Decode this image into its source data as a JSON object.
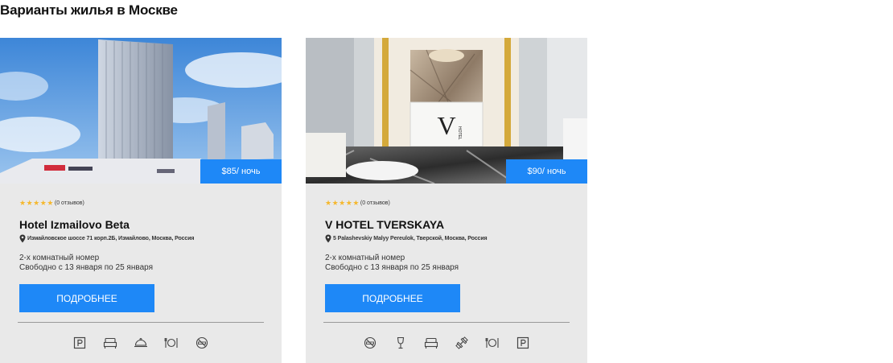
{
  "page": {
    "title": "Варианты жилья в Москве"
  },
  "colors": {
    "accent": "#1e88f7",
    "star": "#f5b82e",
    "card_bg": "#e9e9e9"
  },
  "hotels": [
    {
      "name": "Hotel Izmailovo Beta",
      "price": "$85/ ночь",
      "stars": 5,
      "reviews": "(0 отзывов)",
      "address": "Измайловское шоссе 71 корп.2Б, Измайлово, Москва, Россия",
      "room_type": "2-х комнатный номер",
      "availability": "Свободно с 13 января по 25 января",
      "button_label": "ПОДРОБНЕЕ",
      "photo": "tall-hotel-building-photo",
      "amenities": [
        "parking-icon",
        "bed-icon",
        "room-service-icon",
        "restaurant-icon",
        "no-smoking-icon"
      ]
    },
    {
      "name": "V HOTEL TVERSKAYA",
      "price": "$90/ ночь",
      "stars": 5,
      "reviews": "(0 отзывов)",
      "address": "5 Palashevskiy Malyy Pereulok, Тверской, Москва, Россия",
      "room_type": "2-х комнатный номер",
      "availability": "Свободно с 13 января по 25 января",
      "button_label": "ПОДРОБНЕЕ",
      "photo": "hotel-lobby-reception-photo",
      "photo_logo_letter": "V",
      "photo_logo_text": "HOTEL",
      "amenities": [
        "no-smoking-icon",
        "wine-glass-icon",
        "bed-icon",
        "fitness-icon",
        "restaurant-icon",
        "parking-icon"
      ]
    }
  ]
}
